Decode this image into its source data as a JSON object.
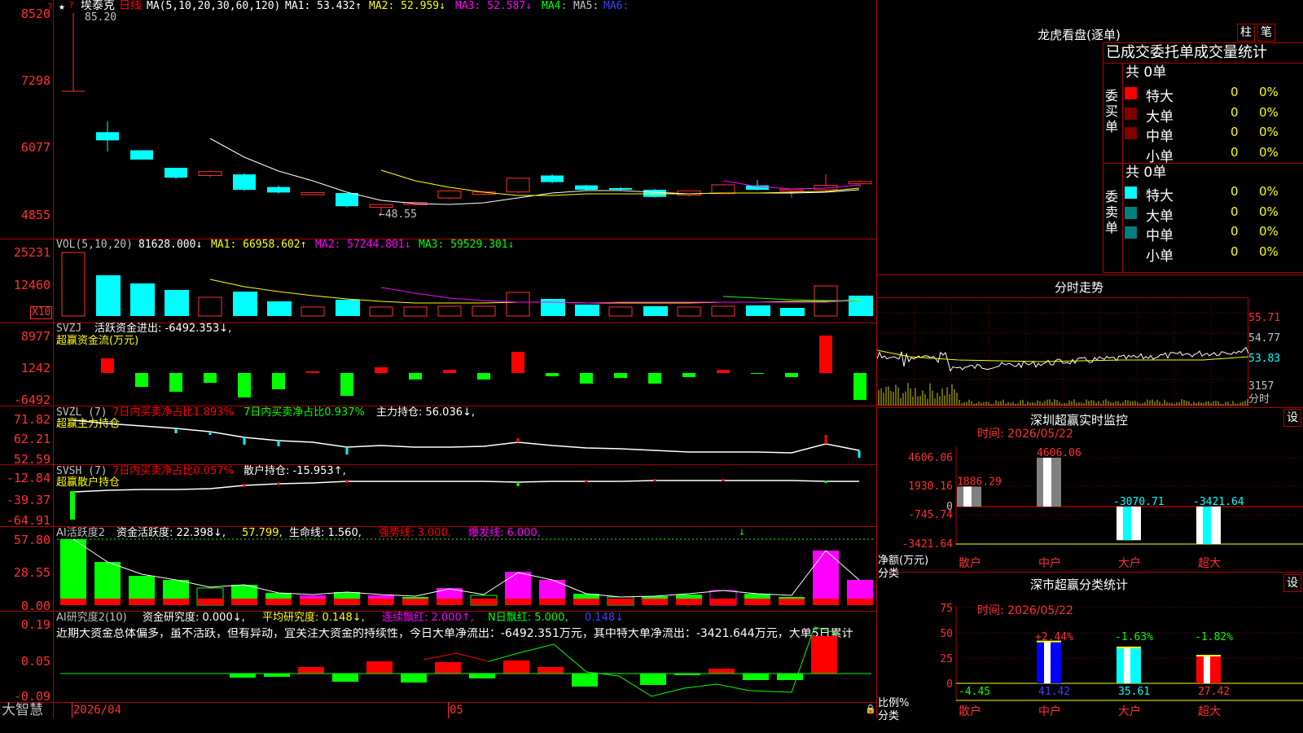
{
  "header": {
    "star": "★",
    "stock_name": "埃泰克",
    "period": "日线",
    "ma_params": "MA(5,10,20,30,60,120)",
    "ma1": "MA1: 53.432↑",
    "ma2": "MA2: 52.959↓",
    "ma3": "MA3: 52.587↓",
    "ma4": "MA4:",
    "ma5": "MA5:",
    "ma6": "MA6:",
    "high_label": "85.20",
    "low_label": "←48.55",
    "red_icon": "?"
  },
  "price_axis": [
    "8520",
    "7298",
    "6077",
    "4855"
  ],
  "vol": {
    "title": "VOL(5,10,20)",
    "value": "81628.000↓",
    "ma1": "MA1: 66958.602↑",
    "ma2": "MA2: 57244.801↓",
    "ma3": "MA3: 59529.301↓",
    "axis": [
      "25231",
      "12460"
    ],
    "unit": "X10"
  },
  "svzj": {
    "title": "SVZJ",
    "desc": "活跃资金进出: -6492.353↓,",
    "name": "超赢资金流(万元)",
    "axis": [
      "8977",
      "1242",
      "-6492"
    ]
  },
  "svzl": {
    "title": "SVZL (7)",
    "buy": "7日内买卖净占比1.893%",
    "net": "7日内买卖净占比0.937%",
    "hold": "主力持仓: 56.036↓,",
    "name": "超赢主力持仓",
    "axis": [
      "71.82",
      "62.21",
      "52.59"
    ]
  },
  "svsh": {
    "title": "SVSH (7)",
    "buy": "7日内买卖净占比0.057%",
    "hold": "散户持仓: -15.953↑,",
    "name": "超赢散户持仓",
    "axis": [
      "-12.84",
      "-39.37",
      "-64.91"
    ]
  },
  "ai_active": {
    "title": "AI活跃度2",
    "desc": "资金活跃度: 22.398↓,",
    "v2": "57.799,",
    "life": "生命线: 1.560,",
    "strong": "强势线: 3.000,",
    "burst": "爆发线: 6.000,",
    "axis": [
      "57.80",
      "28.55",
      "0.00"
    ],
    "arrow": "↓"
  },
  "ai_research": {
    "title": "AI研究度2(10)",
    "desc": "资金研究度: 0.000↓,",
    "avg": "平均研究度: 0.148↓,",
    "cont": "连续飘红: 2.000↑,",
    "nday": "N日飘红: 5.000,",
    "last": "0.148↓",
    "comment": "近期大资金总体偏多，虽不活跃，但有异动，宜关注大资金的持续性，今日大单净流出：-6492.351万元，其中特大单净流出：-3421.644万元，大单5日累计",
    "axis": [
      "0.19",
      "0.05",
      "-0.09"
    ]
  },
  "bottom": {
    "brand": "大智慧",
    "date1": "2026/04",
    "date2": "05"
  },
  "lhb": {
    "title": "龙虎看盘(逐单)",
    "btn1": "柱",
    "btn2": "笔",
    "subtitle": "已成交委托单成交量统计",
    "buy_total": "共 0单",
    "sell_total": "共 0单",
    "buy_side": "委买单",
    "sell_side": "委卖单",
    "buy_rows": [
      {
        "label": "特大",
        "value": "0",
        "pct": "0%",
        "color": "#ff0000"
      },
      {
        "label": "大单",
        "value": "0",
        "pct": "0%",
        "color": "#800000"
      },
      {
        "label": "中单",
        "value": "0",
        "pct": "0%",
        "color": "#800000"
      },
      {
        "label": "小单",
        "value": "0",
        "pct": "0%",
        "color": "#000000"
      }
    ],
    "sell_rows": [
      {
        "label": "特大",
        "value": "0",
        "pct": "0%",
        "color": "#00ffff"
      },
      {
        "label": "大单",
        "value": "0",
        "pct": "0%",
        "color": "#008080"
      },
      {
        "label": "中单",
        "value": "0",
        "pct": "0%",
        "color": "#008080"
      },
      {
        "label": "小单",
        "value": "0",
        "pct": "0%",
        "color": "#000000"
      }
    ]
  },
  "intraday": {
    "title": "分时走势",
    "axis": [
      "55.71",
      "54.77",
      "53.83",
      "3157"
    ],
    "unit": "分时"
  },
  "monitor": {
    "title": "深圳超赢实时监控",
    "set": "设",
    "time": "时间: 2026/05/22",
    "axis": [
      "4606.06",
      "1930.16",
      "0",
      "-745.74",
      "-3421.64"
    ],
    "ylabel": "净额(万元)",
    "xlabel": "分类",
    "values": [
      "1886.29",
      "4606.06",
      "-3070.71",
      "-3421.64"
    ],
    "categories": [
      "散户",
      "中户",
      "大户",
      "超大"
    ]
  },
  "classify": {
    "title": "深市超赢分类统计",
    "set": "设",
    "time": "时间: 2026/05/22",
    "axis": [
      "75",
      "50",
      "25",
      "0"
    ],
    "ylabel": "比例%",
    "xlabel": "分类",
    "changes": [
      "+2.44%",
      "-1.63%",
      "-1.82%"
    ],
    "values": [
      "-4.45",
      "41.42",
      "35.61",
      "27.42"
    ],
    "categories": [
      "散户",
      "中户",
      "大户",
      "超大"
    ]
  },
  "chart_data": [
    {
      "type": "bar",
      "title": "深圳超赢实时监控",
      "ylabel": "净额(万元)",
      "xlabel": "分类",
      "categories": [
        "散户",
        "中户",
        "大户",
        "超大"
      ],
      "values": [
        1886.29,
        4606.06,
        -3070.71,
        -3421.64
      ],
      "ylim": [
        -3421.64,
        4606.06
      ]
    },
    {
      "type": "bar",
      "title": "深市超赢分类统计",
      "ylabel": "比例%",
      "xlabel": "分类",
      "categories": [
        "散户",
        "中户",
        "大户",
        "超大"
      ],
      "values": [
        -4.45,
        41.42,
        35.61,
        27.42
      ],
      "ylim": [
        0,
        75
      ]
    }
  ]
}
